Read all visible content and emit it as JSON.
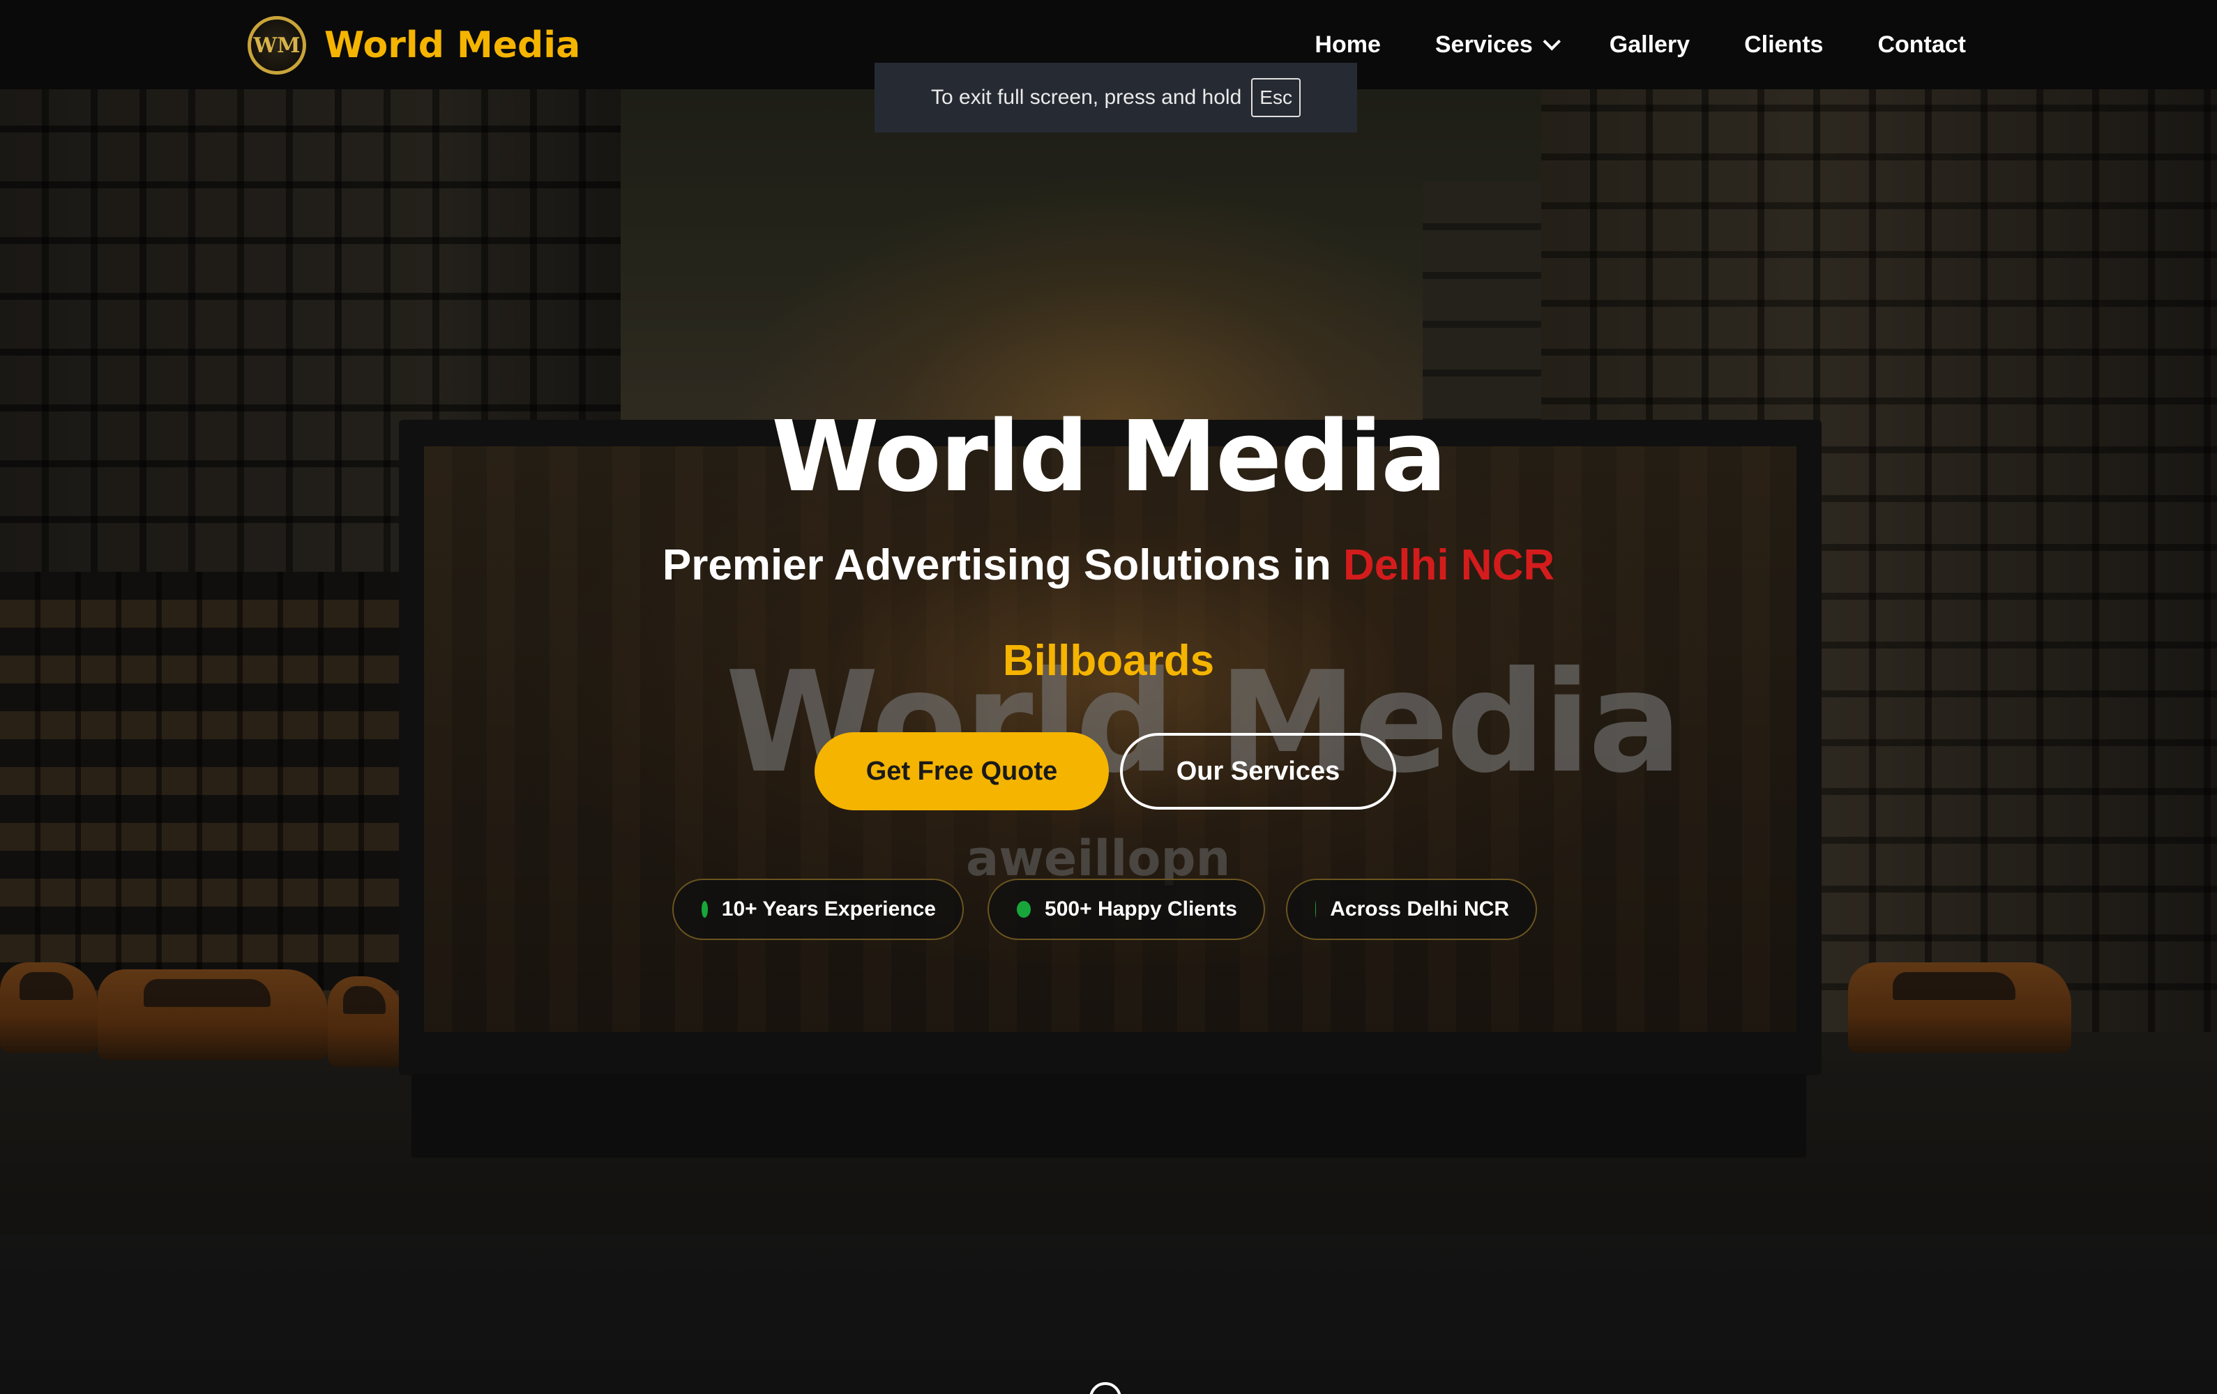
{
  "navbar": {
    "brand": "World Media",
    "logo_icon": "world-media-logo-icon",
    "links": [
      {
        "label": "Home"
      },
      {
        "label": "Services",
        "has_dropdown": true
      },
      {
        "label": "Gallery"
      },
      {
        "label": "Clients"
      },
      {
        "label": "Contact"
      }
    ]
  },
  "fullscreen_notice": {
    "text": "To exit full screen, press and hold",
    "key": "Esc"
  },
  "hero": {
    "title": "World Media",
    "subtitle_prefix": "Premier Advertising Solutions in",
    "subtitle_accent": "Delhi NCR",
    "rotating_word": "Billboards",
    "billboard_text": "World Media",
    "billboard_subtext": "aweillopn",
    "cta_primary": "Get Free Quote",
    "cta_secondary": "Our Services",
    "badges": [
      {
        "label": "10+ Years Experience"
      },
      {
        "label": "500+ Happy Clients"
      },
      {
        "label": "Across Delhi NCR"
      }
    ]
  },
  "colors": {
    "brand_yellow": "#f5b400",
    "accent_red": "#d41c1c",
    "badge_dot_green": "#18a63a",
    "navbar_bg": "#0a0a0a"
  }
}
